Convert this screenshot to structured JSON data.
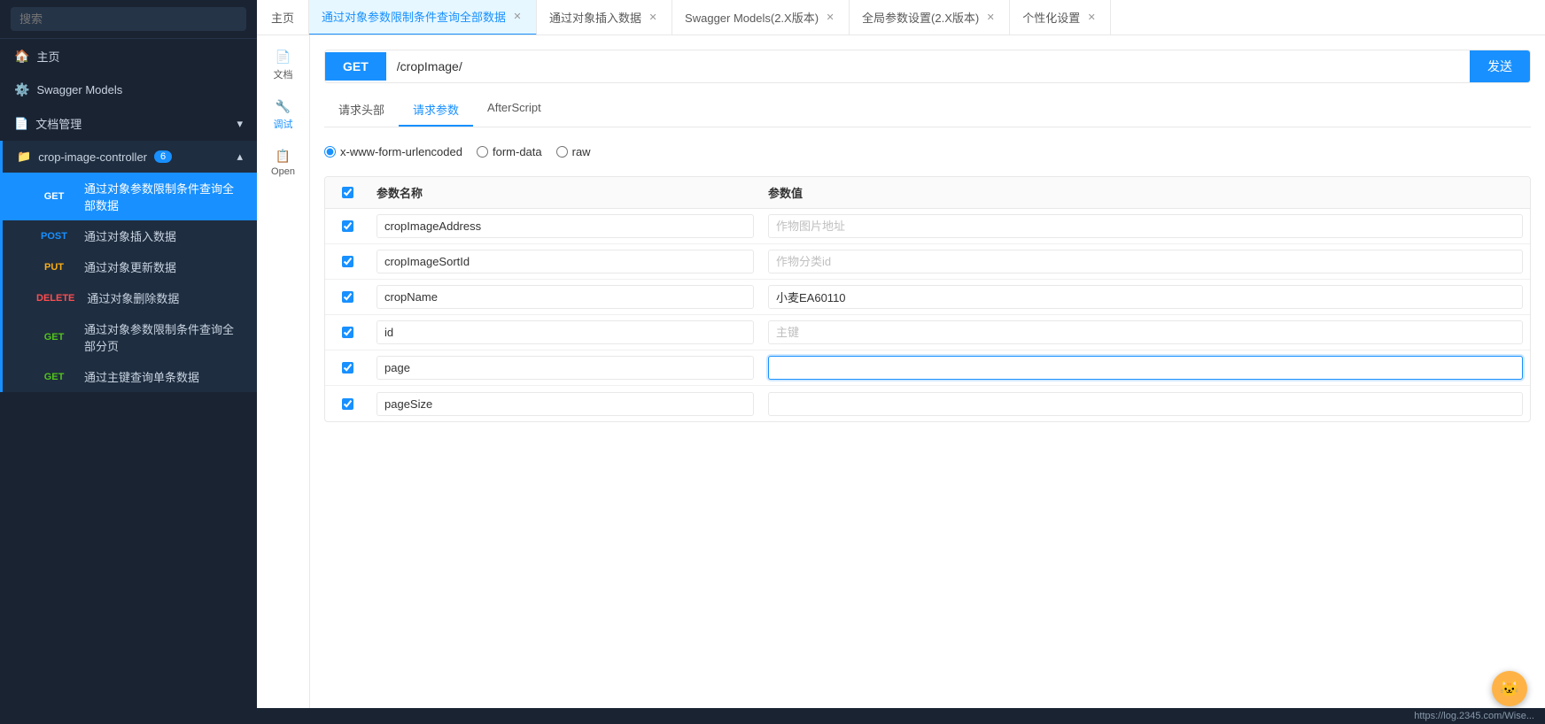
{
  "sidebar": {
    "search_placeholder": "搜索",
    "menu": [
      {
        "id": "home",
        "label": "主页",
        "icon": "🏠"
      },
      {
        "id": "swagger-models",
        "label": "Swagger Models",
        "icon": "⚙️"
      },
      {
        "id": "doc-management",
        "label": "文档管理",
        "icon": "📄",
        "has_arrow": true
      },
      {
        "id": "crop-image-controller",
        "label": "crop-image-controller",
        "icon": "📁",
        "badge": "6",
        "expanded": true
      }
    ],
    "endpoints": [
      {
        "method": "GET",
        "label": "通过对象参数限制条件查询全部数据",
        "active": true
      },
      {
        "method": "POST",
        "label": "通过对象插入数据"
      },
      {
        "method": "PUT",
        "label": "通过对象更新数据"
      },
      {
        "method": "DELETE",
        "label": "通过对象删除数据"
      },
      {
        "method": "GET",
        "label": "通过对象参数限制条件查询全部分页"
      },
      {
        "method": "GET",
        "label": "通过主键查询单条数据"
      }
    ]
  },
  "tabs": [
    {
      "id": "home-tab",
      "label": "主页",
      "closable": false
    },
    {
      "id": "tab-get-all",
      "label": "通过对象参数限制条件查询全部数据",
      "closable": true,
      "active": true
    },
    {
      "id": "tab-insert",
      "label": "通过对象插入数据",
      "closable": true
    },
    {
      "id": "tab-swagger-models",
      "label": "Swagger Models(2.X版本)",
      "closable": true
    },
    {
      "id": "tab-global-settings",
      "label": "全局参数设置(2.X版本)",
      "closable": true
    },
    {
      "id": "tab-personalize",
      "label": "个性化设置",
      "closable": true
    }
  ],
  "left_panel": [
    {
      "id": "doc",
      "label": "文档",
      "icon": "📄"
    },
    {
      "id": "debug",
      "label": "调试",
      "icon": "🔧",
      "active": true
    },
    {
      "id": "open",
      "label": "Open",
      "icon": "📋"
    }
  ],
  "api": {
    "method": "GET",
    "url": "/cropImage/",
    "send_label": "发送",
    "sub_tabs": [
      {
        "id": "request-headers",
        "label": "请求头部"
      },
      {
        "id": "request-params",
        "label": "请求参数",
        "active": true
      },
      {
        "id": "afterscript",
        "label": "AfterScript"
      }
    ],
    "body_types": [
      {
        "id": "x-www-form-urlencoded",
        "label": "x-www-form-urlencoded",
        "selected": true
      },
      {
        "id": "form-data",
        "label": "form-data"
      },
      {
        "id": "raw",
        "label": "raw"
      }
    ],
    "table_headers": {
      "name": "参数名称",
      "value": "参数值"
    },
    "params": [
      {
        "checked": true,
        "name": "cropImageAddress",
        "value": "",
        "placeholder": "作物图片地址"
      },
      {
        "checked": true,
        "name": "cropImageSortId",
        "value": "",
        "placeholder": "作物分类id"
      },
      {
        "checked": true,
        "name": "cropName",
        "value": "小麦EA60110",
        "placeholder": ""
      },
      {
        "checked": true,
        "name": "id",
        "value": "",
        "placeholder": "主键"
      },
      {
        "checked": true,
        "name": "page",
        "value": "",
        "placeholder": "",
        "focused": true
      },
      {
        "checked": true,
        "name": "pageSize",
        "value": "",
        "placeholder": ""
      }
    ]
  },
  "status_bar": {
    "text": "https://log.2345.com/Wise..."
  },
  "avatar": {
    "icon": "🐱"
  }
}
